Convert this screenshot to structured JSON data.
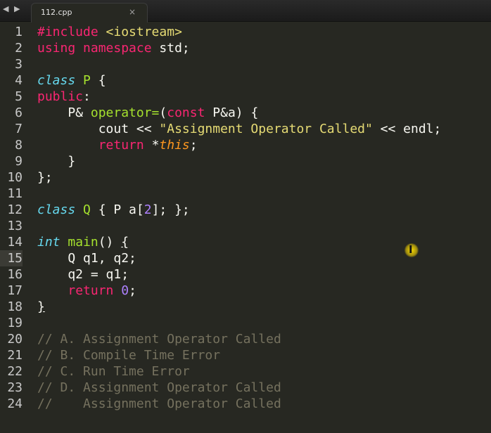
{
  "tab": {
    "title": "112.cpp",
    "close": "×"
  },
  "nav": {
    "back": "◀",
    "forward": "▶"
  },
  "lines": {
    "n1": "1",
    "n2": "2",
    "n3": "3",
    "n4": "4",
    "n5": "5",
    "n6": "6",
    "n7": "7",
    "n8": "8",
    "n9": "9",
    "n10": "10",
    "n11": "11",
    "n12": "12",
    "n13": "13",
    "n14": "14",
    "n15": "15",
    "n16": "16",
    "n17": "17",
    "n18": "18",
    "n19": "19",
    "n20": "20",
    "n21": "21",
    "n22": "22",
    "n23": "23",
    "n24": "24"
  },
  "code": {
    "include": "#include",
    "iostream": " <iostream>",
    "using": "using",
    "namespace": "namespace",
    "std": " std;",
    "class": "class",
    "P": "P",
    "open_brace": " {",
    "public": "public",
    "colon": ":",
    "op_indent": "    P& ",
    "operator": "operator=",
    "paren_open": "(",
    "const": "const",
    "params": " P&a) {",
    "cout": "        cout << ",
    "message": "\"Assignment Operator Called\"",
    "endl": " << endl;",
    "ret_indent": "        ",
    "return": "return",
    "star": " *",
    "this": "this",
    "semi": ";",
    "close_inner": "    }",
    "close_class": "};",
    "Q": "Q",
    "q_body_a": " { P a[",
    "q_size": "2",
    "q_body_b": "]; };",
    "int": "int",
    "main": "main",
    "main_rest": "() ",
    "main_brace": "{",
    "decl": "    Q q1, q2;",
    "assign": "    q2 = q1;",
    "ret0_indent": "    ",
    "zero": "0",
    "end_brace": "}",
    "c20": "// A. Assignment Operator Called",
    "c21": "// B. Compile Time Error",
    "c22": "// C. Run Time Error",
    "c23": "// D. Assignment Operator Called",
    "c24": "//    Assignment Operator Called"
  }
}
